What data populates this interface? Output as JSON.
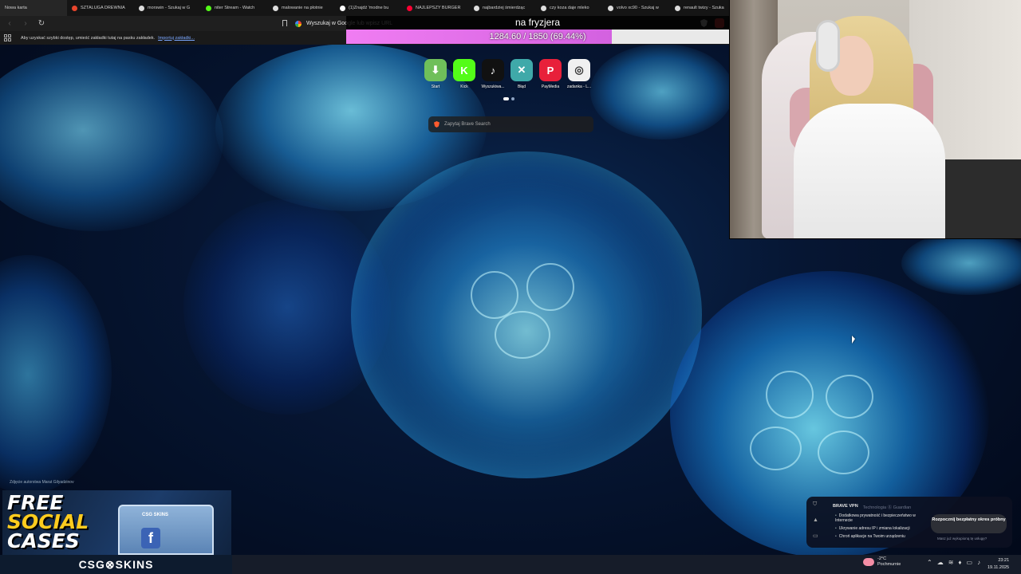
{
  "tabs": [
    {
      "label": "Nowa karta",
      "color": "#333333"
    },
    {
      "label": "SZTALUGA DREWNIA",
      "color": "#e8452c"
    },
    {
      "label": "morswin - Szukaj w G",
      "color": "#dddddd"
    },
    {
      "label": "niter Stream - Watch",
      "color": "#53fc18"
    },
    {
      "label": "malowanie na płotnie",
      "color": "#dddddd"
    },
    {
      "label": "(1)Znajdź 'modne bu",
      "color": "#ffffff"
    },
    {
      "label": "NAJLEPSZY BURGER",
      "color": "#ff0033"
    },
    {
      "label": "najbardziej śmierdząc",
      "color": "#dddddd"
    },
    {
      "label": "czy koza daje mleko",
      "color": "#dddddd"
    },
    {
      "label": "volvo xc90 - Szukaj w",
      "color": "#dddddd"
    },
    {
      "label": "renault twizy - Szuka",
      "color": "#dddddd"
    }
  ],
  "toolbar": {
    "back_icon": "‹",
    "forward_icon": "›",
    "reload_icon": "↻",
    "url_placeholder": "Wyszukaj w Google lub wpisz URL"
  },
  "bookmarks": {
    "message": "Aby uzyskać szybki dostęp, umieść zakładki tutaj na pasku zakładek.",
    "link": "Importuj zakładki..."
  },
  "overlay": {
    "title": "na fryzjera",
    "progress_text": "1284.60 / 1850 (69.44%)",
    "progress_fraction": 0.6944
  },
  "shortcuts": [
    {
      "label": "Start",
      "glyph": "⬇",
      "color": "#6fbf5a"
    },
    {
      "label": "Kick",
      "glyph": "K",
      "color": "#53fc18"
    },
    {
      "label": "Wyszukiwa...",
      "glyph": "♪",
      "color": "#111111"
    },
    {
      "label": "Błąd",
      "glyph": "✕",
      "color": "#3fa9a9"
    },
    {
      "label": "PayMedia",
      "glyph": "P",
      "color": "#e8203a"
    },
    {
      "label": "zadanka - L...",
      "glyph": "◎",
      "color": "#f0f0f0"
    }
  ],
  "search": {
    "placeholder": "Zapytaj Brave Search"
  },
  "credit": "Zdjęcie autorstwa Marat Gilyadzinov",
  "ad": {
    "line1": "FREE",
    "line2": "SOCIAL",
    "line3": "CASES",
    "box_label": "CSG SKINS",
    "brand": "CSG⊗SKINS"
  },
  "vpn": {
    "title": "BRAVE VPN",
    "tech": "Technologia ⓖ Guardian",
    "items": [
      "Dodatkowa prywatność i bezpieczeństwo w Internecie",
      "Ukrywanie adresu IP i zmiana lokalizacji",
      "Chroń aplikacje na Twoim urządzeniu"
    ],
    "cta": "Rozpocznij bezpłatny okres próbny",
    "owned": "Masz już wykupioną tę usługę?"
  },
  "taskbar": {
    "temp": "-2°C",
    "weather": "Pochmurnie",
    "time": "23:21",
    "date": "19.11.2025"
  }
}
